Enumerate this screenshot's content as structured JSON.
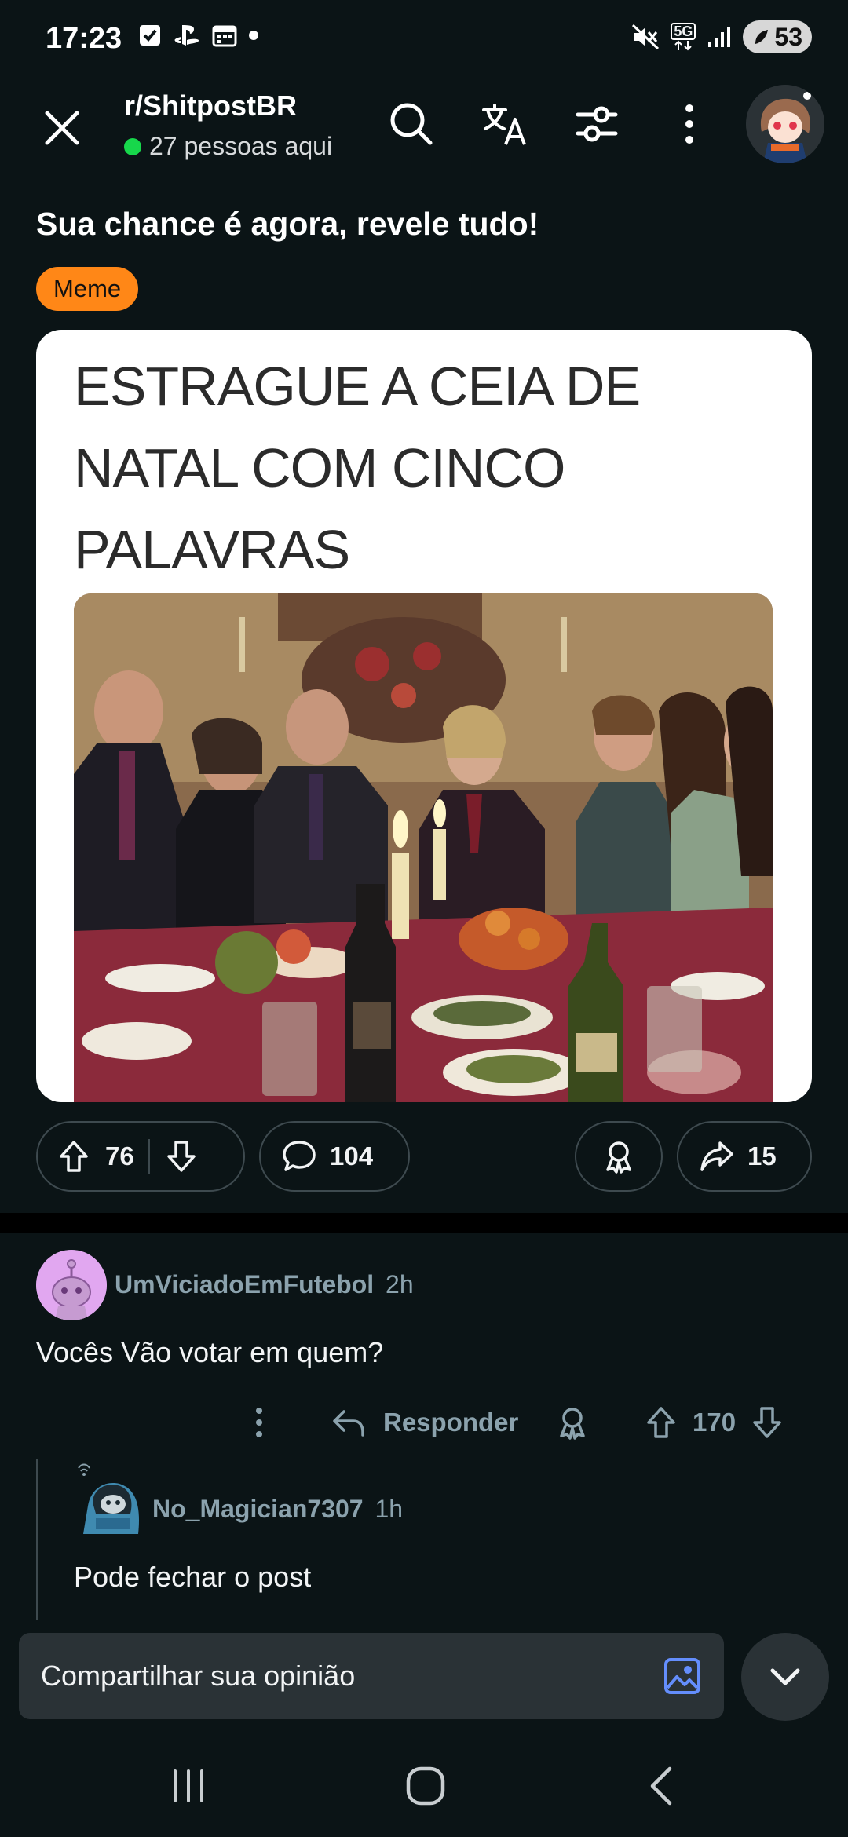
{
  "status_bar": {
    "time": "17:23",
    "battery": "53",
    "network": "5G",
    "icons": [
      "check-box-icon",
      "playstation-icon",
      "calendar-icon",
      "dot-icon",
      "mute-icon",
      "signal-icon",
      "battery-icon"
    ]
  },
  "header": {
    "subreddit": "r/ShitpostBR",
    "online": "27 pessoas aqui",
    "icons": [
      "close-icon",
      "search-icon",
      "translate-icon",
      "filter-icon",
      "more-icon",
      "avatar"
    ]
  },
  "post": {
    "title": "Sua chance é agora, revele tudo!",
    "flair": "Meme",
    "meme_lines": [
      "ESTRAGUE A CEIA DE",
      "NATAL COM CINCO",
      "PALAVRAS"
    ],
    "votes": "76",
    "comments": "104",
    "shares": "15"
  },
  "comments": [
    {
      "user": "UmViciadoEmFutebol",
      "age": "2h",
      "text": "Vocês Vão votar em quem?",
      "reply_label": "Responder",
      "votes": "170"
    },
    {
      "user": "No_Magician7307",
      "age": "1h",
      "text": "Pode fechar o post"
    }
  ],
  "composer": {
    "placeholder": "Compartilhar sua opinião"
  },
  "colors": {
    "background": "#0b1416",
    "flair": "#ff8717",
    "online_dot": "#17d74b",
    "image_icon": "#648efc"
  }
}
